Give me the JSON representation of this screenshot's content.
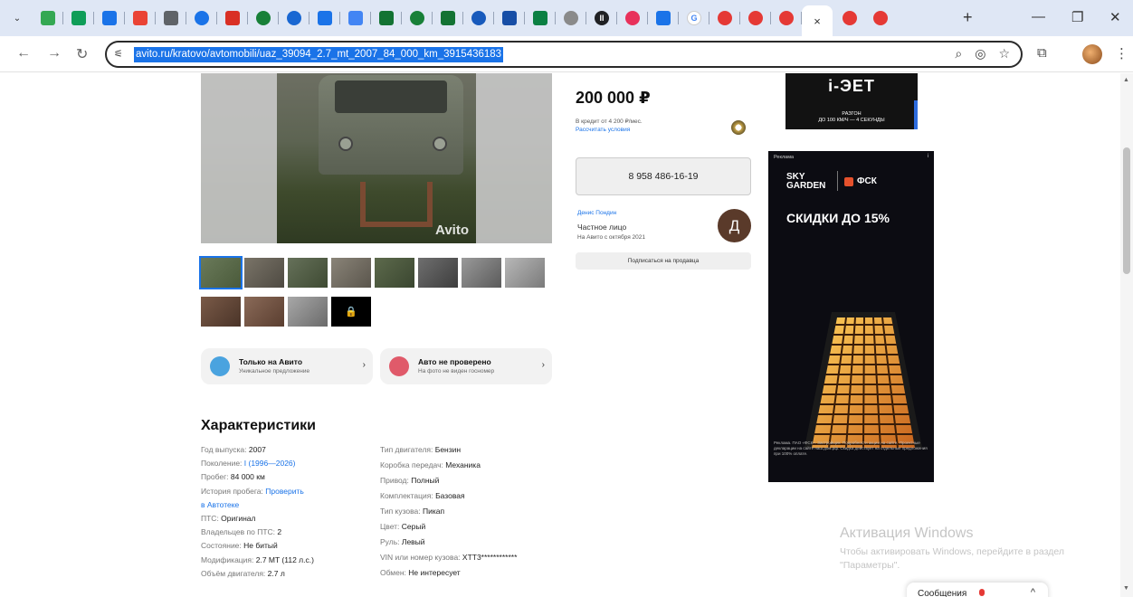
{
  "browser": {
    "tabs": [
      {
        "icon": "google-docs-icon",
        "color": "#34a853",
        "glyph": "",
        "round": false
      },
      {
        "icon": "sheets-icon",
        "color": "#0f9d58",
        "glyph": "",
        "round": false
      },
      {
        "icon": "bookmark-icon",
        "color": "#1a73e8",
        "glyph": "",
        "round": false
      },
      {
        "icon": "gmail-icon",
        "color": "#ea4335",
        "glyph": "",
        "round": false
      },
      {
        "icon": "grid-app-icon",
        "color": "#5f6368",
        "glyph": "",
        "round": false
      },
      {
        "icon": "chrome-icon",
        "color": "#1a73e8",
        "glyph": "",
        "round": true
      },
      {
        "icon": "red-app-icon",
        "color": "#d93025",
        "glyph": "",
        "round": false
      },
      {
        "icon": "green-circle-icon",
        "color": "#188038",
        "glyph": "",
        "round": true
      },
      {
        "icon": "blue-circle-icon",
        "color": "#1967d2",
        "glyph": "",
        "round": true
      },
      {
        "icon": "square-app-icon",
        "color": "#1a73e8",
        "glyph": "",
        "round": false
      },
      {
        "icon": "doc-app-icon",
        "color": "#4285f4",
        "glyph": "",
        "round": false
      },
      {
        "icon": "photo-app-icon",
        "color": "#137333",
        "glyph": "",
        "round": false
      },
      {
        "icon": "check-circle-icon",
        "color": "#188038",
        "glyph": "",
        "round": true
      },
      {
        "icon": "image-app-icon",
        "color": "#137333",
        "glyph": "",
        "round": false
      },
      {
        "icon": "emblem-icon",
        "color": "#185abc",
        "glyph": "",
        "round": true
      },
      {
        "icon": "map-app-icon",
        "color": "#174ea6",
        "glyph": "",
        "round": false
      },
      {
        "icon": "green-app-icon",
        "color": "#0b8043",
        "glyph": "",
        "round": false
      },
      {
        "icon": "crest-icon",
        "color": "#8a8a8a",
        "glyph": "",
        "round": true
      },
      {
        "icon": "pause-icon",
        "color": "#202124",
        "glyph": "II",
        "round": true
      },
      {
        "icon": "avito-icon",
        "color": "#e8315b",
        "glyph": "",
        "round": true
      },
      {
        "icon": "mail-app-icon",
        "color": "#1a73e8",
        "glyph": "",
        "round": false
      },
      {
        "icon": "google-icon",
        "color": "#ffffff",
        "glyph": "G",
        "round": true
      },
      {
        "icon": "record-icon",
        "color": "#e53935",
        "glyph": "",
        "round": true
      },
      {
        "icon": "record-icon",
        "color": "#e53935",
        "glyph": "",
        "round": true
      },
      {
        "icon": "record-icon",
        "color": "#e53935",
        "glyph": "",
        "round": true
      }
    ],
    "active_tab_close": "×",
    "after_tabs": [
      {
        "icon": "record-icon",
        "color": "#e53935"
      },
      {
        "icon": "record-icon",
        "color": "#e53935"
      }
    ],
    "new_tab": "+",
    "url": "avito.ru/kratovo/avtomobili/uaz_39094_2.7_mt_2007_84_000_km_3915436183"
  },
  "photos": {
    "watermark": "Avito",
    "thumbs": [
      {
        "c1": "#6a7a5a",
        "c2": "#4a5a3a"
      },
      {
        "c1": "#7a7468",
        "c2": "#4e4a42"
      },
      {
        "c1": "#66715a",
        "c2": "#3e4a32"
      },
      {
        "c1": "#8a8478",
        "c2": "#5a554c"
      },
      {
        "c1": "#5d6a4c",
        "c2": "#3a4630"
      },
      {
        "c1": "#6f6f6f",
        "c2": "#3d3d3d"
      },
      {
        "c1": "#9a9a9a",
        "c2": "#5a5a5a"
      },
      {
        "c1": "#b8b8b8",
        "c2": "#7a7a7a"
      },
      {
        "c1": "#7a5a48",
        "c2": "#4a3428"
      },
      {
        "c1": "#8a6a58",
        "c2": "#5a3e30"
      },
      {
        "c1": "#a8a8a8",
        "c2": "#6a6a6a"
      }
    ],
    "more_icon": "lock-icon"
  },
  "promos": [
    {
      "title": "Только на Авито",
      "subtitle": "Уникальное предложение",
      "icon_color": "#4aa3df"
    },
    {
      "title": "Авто не проверено",
      "subtitle": "На фото не виден госномер",
      "icon_color": "#e05a6a"
    }
  ],
  "characteristics": {
    "title": "Характеристики",
    "left": [
      {
        "label": "Год выпуска: ",
        "value": "2007",
        "link": false
      },
      {
        "label": "Поколение: ",
        "value": "I (1996—2026)",
        "link": true
      },
      {
        "label": "Пробег: ",
        "value": "84 000 км",
        "link": false
      },
      {
        "label": "История пробега: ",
        "value": "Проверить",
        "link": true
      },
      {
        "label": "",
        "value": "в Автотеке",
        "link": true
      },
      {
        "label": "ПТС: ",
        "value": "Оригинал",
        "link": false
      },
      {
        "label": "Владельцев по ПТС: ",
        "value": "2",
        "link": false
      },
      {
        "label": "Состояние: ",
        "value": "Не битый",
        "link": false
      },
      {
        "label": "Модификация: ",
        "value": "2.7 MT (112 л.с.)",
        "link": false
      },
      {
        "label": "Объём двигателя: ",
        "value": "2.7 л",
        "link": false
      }
    ],
    "right": [
      {
        "label": "Тип двигателя: ",
        "value": "Бензин"
      },
      {
        "label": "Коробка передач: ",
        "value": "Механика"
      },
      {
        "label": "Привод: ",
        "value": "Полный"
      },
      {
        "label": "Комплектация: ",
        "value": "Базовая"
      },
      {
        "label": "Тип кузова: ",
        "value": "Пикап"
      },
      {
        "label": "Цвет: ",
        "value": "Серый"
      },
      {
        "label": "Руль: ",
        "value": "Левый"
      },
      {
        "label": "VIN или номер кузова: ",
        "value": "XTT3************"
      },
      {
        "label": "Обмен: ",
        "value": "Не интересует"
      }
    ]
  },
  "listing": {
    "price": "200 000 ₽",
    "credit": "В кредит от 4 200 ₽/мес.",
    "calc_link": "Рассчитать условия",
    "phone": "8 958 486-16-19",
    "seller_name": "Денис Пондин",
    "seller_type": "Частное лицо",
    "seller_since": "На Авито с октября 2021",
    "avatar_letter": "Д",
    "subscribe": "Подписаться на продавца"
  },
  "ad_top": {
    "logo": "i-ЭET",
    "line1": "РАЗГОН",
    "line2": "ДО 100 КМ/Ч — 4 СЕКУНДЫ"
  },
  "ad_side": {
    "label": "Реклама",
    "info": "i",
    "brand1_line1": "SKY",
    "brand1_line2": "GARDEN",
    "brand2": "ФСК",
    "headline": "СКИДКИ ДО 15%",
    "footer": "Реклама. ПАО «ФСК». Застройщик. Подробности акции на сайте. Проектные декларации на сайте наш.дом.рф. Скидка действует на отдельные предложения при 100% оплате."
  },
  "windows": {
    "line1": "Активация Windows",
    "line2": "Чтобы активировать Windows, перейдите в раздел \"Параметры\"."
  },
  "messages": {
    "label": "Сообщения",
    "chevron": "^"
  }
}
